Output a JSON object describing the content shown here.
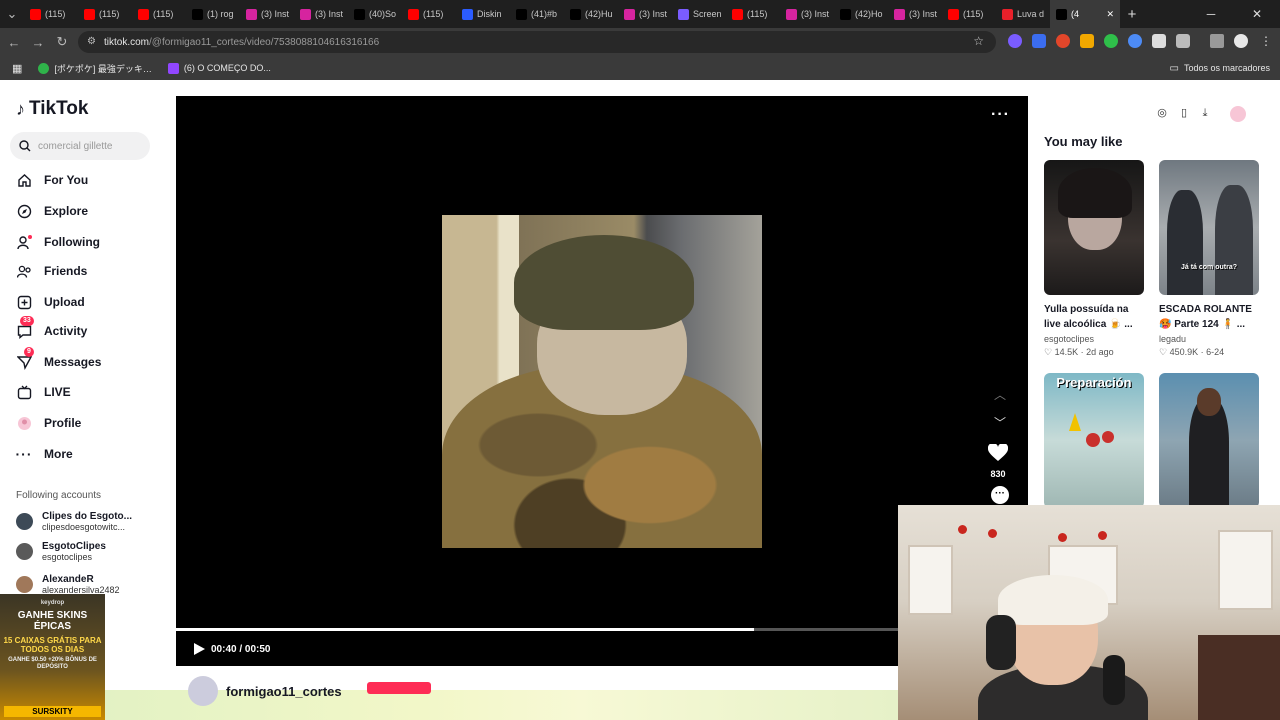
{
  "browser": {
    "tabs": [
      {
        "label": "(115)",
        "icon": "youtube-icon",
        "color": "#ff0000"
      },
      {
        "label": "(115)",
        "icon": "youtube-icon",
        "color": "#ff0000"
      },
      {
        "label": "(115)",
        "icon": "youtube-icon",
        "color": "#ff0000"
      },
      {
        "label": "(1) rog",
        "icon": "x-icon",
        "color": "#000000"
      },
      {
        "label": "(3) Inst",
        "icon": "instagram-icon",
        "color": "#d6249f"
      },
      {
        "label": "(3) Inst",
        "icon": "instagram-icon",
        "color": "#d6249f"
      },
      {
        "label": "(40)So",
        "icon": "tiktok-icon",
        "color": "#000000"
      },
      {
        "label": "(115)",
        "icon": "youtube-icon",
        "color": "#ff0000"
      },
      {
        "label": "Diskin",
        "icon": "app-icon",
        "color": "#2b5cff"
      },
      {
        "label": "(41)#b",
        "icon": "tiktok-icon",
        "color": "#000000"
      },
      {
        "label": "(42)Hu",
        "icon": "tiktok-icon",
        "color": "#000000"
      },
      {
        "label": "(3) Inst",
        "icon": "instagram-icon",
        "color": "#d6249f"
      },
      {
        "label": "Screen",
        "icon": "feather-icon",
        "color": "#7a5cff"
      },
      {
        "label": "(115)",
        "icon": "youtube-icon",
        "color": "#ff0000"
      },
      {
        "label": "(3) Inst",
        "icon": "instagram-icon",
        "color": "#d6249f"
      },
      {
        "label": "(42)Ho",
        "icon": "tiktok-icon",
        "color": "#000000"
      },
      {
        "label": "(3) Inst",
        "icon": "instagram-icon",
        "color": "#d6249f"
      },
      {
        "label": "(115)",
        "icon": "youtube-icon",
        "color": "#ff0000"
      },
      {
        "label": "Luva d",
        "icon": "store-icon",
        "color": "#e8202a"
      },
      {
        "label": "(4",
        "icon": "tiktok-icon",
        "color": "#000000",
        "active": true
      }
    ],
    "url_domain": "tiktok.com",
    "url_path": "/@formigao11_cortes/video/7538088104616316166",
    "bookmarks": [
      {
        "label": "[ポケポケ] 最強デッキ…",
        "icon": "bookmark-icon"
      },
      {
        "label": "(6) O COMEÇO DO...",
        "icon": "twitch-icon"
      }
    ],
    "all_bookmarks": "Todos os marcadores"
  },
  "sidebar": {
    "logo": "TikTok",
    "search_placeholder": "comercial gillette",
    "nav": [
      {
        "label": "For You",
        "icon": "home-icon"
      },
      {
        "label": "Explore",
        "icon": "compass-icon"
      },
      {
        "label": "Following",
        "icon": "following-icon"
      },
      {
        "label": "Friends",
        "icon": "friends-icon"
      },
      {
        "label": "Upload",
        "icon": "upload-icon"
      },
      {
        "label": "Activity",
        "icon": "activity-icon",
        "badge": "33"
      },
      {
        "label": "Messages",
        "icon": "messages-icon",
        "badge": "9"
      },
      {
        "label": "LIVE",
        "icon": "live-icon"
      },
      {
        "label": "Profile",
        "icon": "profile-icon"
      },
      {
        "label": "More",
        "icon": "more-icon"
      }
    ],
    "following_title": "Following accounts",
    "accounts": [
      {
        "name": "Clipes do Esgoto...",
        "handle": "clipesdoesgotowitc..."
      },
      {
        "name": "EsgotoClipes",
        "handle": "esgotoclipes"
      },
      {
        "name": "AlexandeR",
        "handle": "alexandersilva2482"
      }
    ]
  },
  "ad": {
    "brand": "keydrop",
    "headline": "GANHE SKINS ÉPICAS",
    "offer": "15 CAIXAS GRÁTIS PARA TODOS OS DIAS",
    "bonus": "GANHE $0.50 +20% BÔNUS DE DEPÓSITO",
    "code": "SURSKITY"
  },
  "player": {
    "time": "00:40 / 00:50",
    "likes": "830",
    "progress": 0.8
  },
  "author": {
    "name": "formigao11_cortes"
  },
  "recommendations": {
    "title": "You may like",
    "cards": [
      {
        "title": "Yulla possuída na live alcoólica 🍺 ...",
        "author": "esgotoclipes",
        "likes": "14.5K",
        "age": "2d ago"
      },
      {
        "title": "ESCADA ROLANTE 🥵 Parte 124 🧍 ...",
        "author": "legadu",
        "likes": "450.9K",
        "age": "6-24",
        "overlay": "Já tá com outra?"
      },
      {
        "title": "",
        "author": "",
        "likes": "",
        "age": "",
        "overlay": "Preparación"
      },
      {
        "title": "",
        "author": "",
        "likes": "",
        "age": ""
      }
    ]
  }
}
